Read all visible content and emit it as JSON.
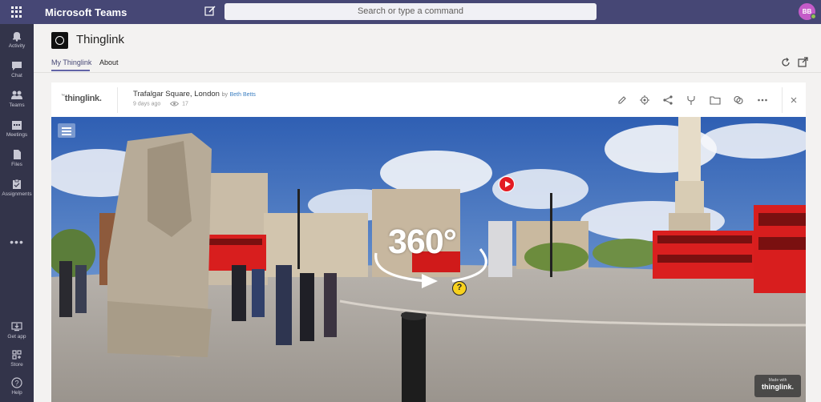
{
  "topbar": {
    "app_title": "Microsoft Teams",
    "search_placeholder": "Search or type a command",
    "avatar_initials": "BB"
  },
  "rail": {
    "items": [
      {
        "label": "Activity",
        "icon": "bell-icon"
      },
      {
        "label": "Chat",
        "icon": "chat-icon"
      },
      {
        "label": "Teams",
        "icon": "teams-icon"
      },
      {
        "label": "Meetings",
        "icon": "calendar-icon"
      },
      {
        "label": "Files",
        "icon": "file-icon"
      },
      {
        "label": "Assignments",
        "icon": "assignments-icon"
      }
    ],
    "more": "•••",
    "bottom_items": [
      {
        "label": "Get app",
        "icon": "download-icon"
      },
      {
        "label": "Store",
        "icon": "store-icon"
      },
      {
        "label": "Help",
        "icon": "help-icon"
      }
    ]
  },
  "app_header": {
    "name": "Thinglink",
    "tabs": [
      {
        "label": "My Thinglink",
        "active": true
      },
      {
        "label": "About",
        "active": false
      }
    ]
  },
  "card": {
    "brand": "thinglink.",
    "brand_prefix": "™",
    "title": "Trafalgar Square, London",
    "by": "by",
    "author": "Beth Betts",
    "age": "9 days ago",
    "views": "17",
    "tools": [
      "edit-icon",
      "settings-icon",
      "share-icon",
      "fork-icon",
      "folder-icon",
      "copy-icon",
      "more-icon",
      "close-icon"
    ]
  },
  "scene": {
    "badge": "360°",
    "help_tag": "?",
    "made_with_small": "Made with",
    "made_with_brand": "thinglink."
  },
  "colors": {
    "topbar": "#464775",
    "rail": "#33344a",
    "accent": "#6264a7",
    "play_tag": "#e31b23",
    "help_tag": "#f7d11e"
  }
}
